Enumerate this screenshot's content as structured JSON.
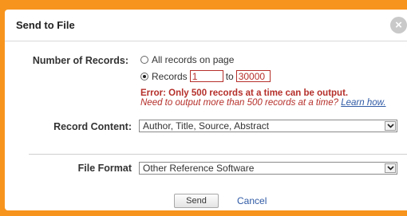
{
  "dialog": {
    "title": "Send to File",
    "close_label": "×"
  },
  "records": {
    "label": "Number of Records:",
    "option_all": "All records on page",
    "option_range": "Records",
    "selected": "range",
    "from_value": "1",
    "to_label": "to",
    "to_value": "30000"
  },
  "error": {
    "main": "Error: Only 500 records at a time can be output.",
    "sub": "Need to output more than 500 records at a time?",
    "link": "Learn how."
  },
  "content": {
    "label": "Record Content:",
    "value": "Author, Title, Source, Abstract"
  },
  "format": {
    "label": "File Format",
    "value": "Other Reference Software"
  },
  "actions": {
    "send": "Send",
    "cancel": "Cancel"
  },
  "colors": {
    "frame": "#f7941d",
    "error": "#b5302b",
    "link": "#2f5aa5"
  },
  "icons": {
    "close": "close-icon",
    "dropdown": "chevron-down-icon"
  }
}
